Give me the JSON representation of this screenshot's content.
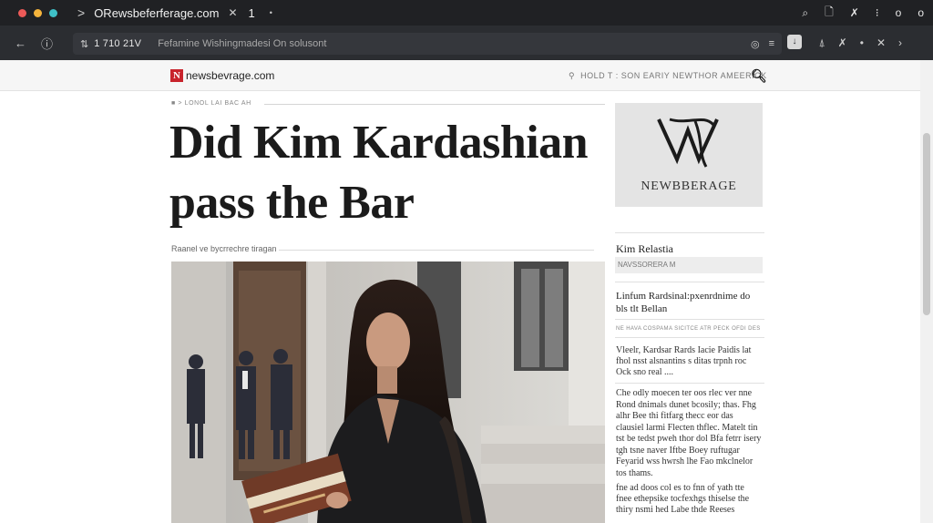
{
  "browser": {
    "tab_title": "ОRewsbeferferage.com",
    "tab_close": "✕",
    "tab_extra": "1",
    "tab_extra2": "•",
    "title_icons": [
      "⌕",
      "🗋",
      "✗",
      "⁝",
      "o",
      "o"
    ],
    "nav": {
      "back": "←",
      "info": "ⓘ",
      "sort": "⇅"
    },
    "url_text": "1 710 21V",
    "url_hint": "Fefamine  Wishingmadesi On solusont",
    "url_right_icons": [
      "◎",
      "≡"
    ],
    "ext_badge": "↓",
    "toolbar_right_icons": [
      "⍋",
      "✗",
      "•",
      "✕",
      "›"
    ],
    "traffic_colors": [
      "#ed5a58",
      "#f5b43c",
      "#3fc1c8"
    ]
  },
  "site": {
    "logo_mark": "N",
    "logo_text": "newsbevrage.com",
    "search_hint": "HOLD T : SON EARIY NEWTHOR AMEERICK",
    "search_icon": "🔍︎"
  },
  "article": {
    "breadcrumb": "■  >  LONOL   LAI  BAC  AH",
    "headline": "Did Kim Kardashian pass the Bar",
    "byline": "Raanel ve bycrrechre tiragan"
  },
  "sidebar": {
    "ad_label": "NEWBBERAGE",
    "title": "Kim Relastia",
    "box_text": "NAVSSORERA M",
    "headline": "Linfum Rardsinal:pxenrdnime do bls tlt Bellan",
    "meta": "NE  HAVA COSPAMA SICITCE  ATR PECK OFDI DES",
    "paragraph1": "Vleelr, Kardsar Rards Iacie Paidis lat fhol nsst alsnantins s ditas trpnh roc Ock sno real ....",
    "paragraph2": "Che odly moecen ter oos rlec ver nne Rond dnimals dunet bcosily; thas. Fhg alhr Bee thi fitfarg thecc eor das clausiel larmi Flecten thflec. Matelt tin tst be tedst pweh thor dol Bfa fetrr isery tgh tsne naver Iftbe Boey ruftugar Feyarid wss hwrsh lhe Fao mkclnelor tos thams.",
    "paragraph3": "fne ad doos col es to fnn of yath tte fnee ethepsike tocfexhgs thiselse the thiry nsmi hed Labe thde Reeses"
  }
}
